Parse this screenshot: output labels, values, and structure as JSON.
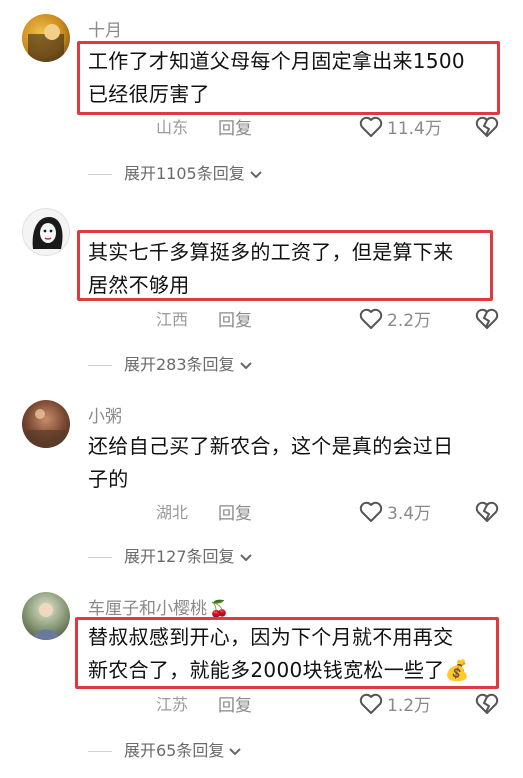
{
  "comments": [
    {
      "username": "十月",
      "lines": [
        "工作了才知道父母每个月固定拿出来1500",
        "已经很厉害了"
      ],
      "location": "山东",
      "reply_label": "回复",
      "like_count": "11.4万",
      "expand_label": "展开1105条回复"
    },
    {
      "username": "",
      "lines": [
        "其实七千多算挺多的工资了，但是算下来",
        "居然不够用"
      ],
      "location": "江西",
      "reply_label": "回复",
      "like_count": "2.2万",
      "expand_label": "展开283条回复"
    },
    {
      "username": "小粥",
      "lines": [
        "还给自己买了新农合，这个是真的会过日",
        "子的"
      ],
      "location": "湖北",
      "reply_label": "回复",
      "like_count": "3.4万",
      "expand_label": "展开127条回复"
    },
    {
      "username": "车厘子和小樱桃",
      "username_emoji": "🍒",
      "lines": [
        "替叔叔感到开心，因为下个月就不用再交",
        "新农合了，就能多2000块钱宽松一些了"
      ],
      "trailing_emoji": "💰",
      "location": "江苏",
      "reply_label": "回复",
      "like_count": "1.2万",
      "expand_label": "展开65条回复"
    }
  ],
  "colors": {
    "highlight_border": "#e03a3e",
    "meta_text": "#8a8a8a"
  }
}
